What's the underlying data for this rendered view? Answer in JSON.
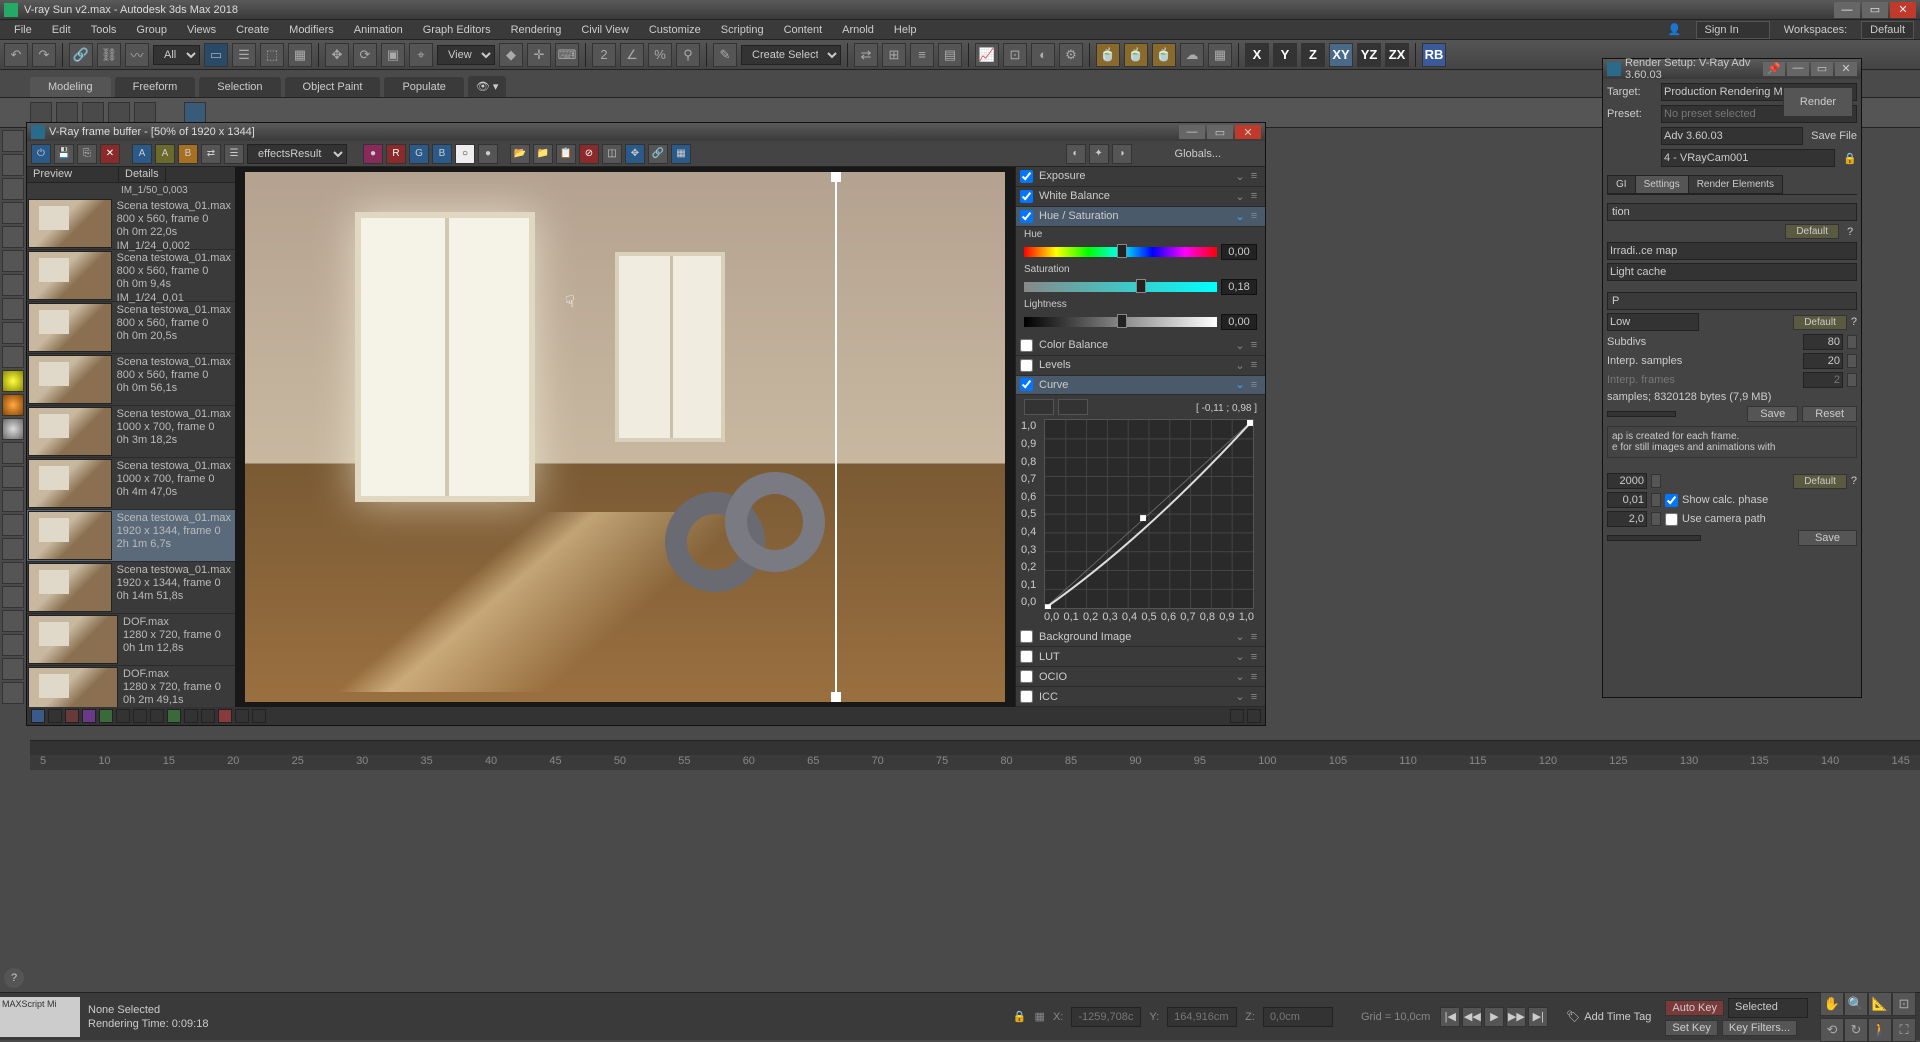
{
  "app": {
    "title": "V-ray Sun v2.max - Autodesk 3ds Max 2018",
    "signin": "Sign In",
    "workspaces_label": "Workspaces:",
    "workspaces_value": "Default"
  },
  "menu": [
    "File",
    "Edit",
    "Tools",
    "Group",
    "Views",
    "Create",
    "Modifiers",
    "Animation",
    "Graph Editors",
    "Rendering",
    "Civil View",
    "Customize",
    "Scripting",
    "Content",
    "Arnold",
    "Help"
  ],
  "toolbar_selects": {
    "all": "All",
    "view": "View",
    "selset": "Create Selection Se"
  },
  "axis_buttons": [
    "X",
    "Y",
    "Z",
    "XY",
    "YZ",
    "ZX"
  ],
  "rb_button": "RB",
  "ribbon": {
    "tabs": [
      "Modeling",
      "Freeform",
      "Selection",
      "Object Paint",
      "Populate"
    ],
    "active": "Modeling"
  },
  "vfb": {
    "title": "V-Ray frame buffer - [50% of 1920 x 1344]",
    "channel": "effectsResult",
    "globals": "Globals...",
    "letters": {
      "a": "A",
      "a2": "A",
      "b": "B"
    },
    "history": {
      "headers": {
        "preview": "Preview",
        "details": "Details"
      },
      "first_line": "IM_1/50_0,003",
      "items": [
        {
          "file": "Scena testowa_01.max",
          "res": "800 x 560, frame 0",
          "time": "0h 0m 22,0s",
          "im": "IM_1/24_0,002"
        },
        {
          "file": "Scena testowa_01.max",
          "res": "800 x 560, frame 0",
          "time": "0h 0m 9,4s",
          "im": "IM_1/24_0,01"
        },
        {
          "file": "Scena testowa_01.max",
          "res": "800 x 560, frame 0",
          "time": "0h 0m 20,5s",
          "im": ""
        },
        {
          "file": "Scena testowa_01.max",
          "res": "800 x 560, frame 0",
          "time": "0h 0m 56,1s",
          "im": ""
        },
        {
          "file": "Scena testowa_01.max",
          "res": "1000 x 700, frame 0",
          "time": "0h 3m 18,2s",
          "im": ""
        },
        {
          "file": "Scena testowa_01.max",
          "res": "1000 x 700, frame 0",
          "time": "0h 4m 47,0s",
          "im": ""
        },
        {
          "file": "Scena testowa_01.max",
          "res": "1920 x 1344, frame 0",
          "time": "2h 1m 6,7s",
          "im": "",
          "selected": true
        },
        {
          "file": "Scena testowa_01.max",
          "res": "1920 x 1344, frame 0",
          "time": "0h 14m 51,8s",
          "im": ""
        },
        {
          "file": "DOF.max",
          "res": "1280 x 720, frame 0",
          "time": "0h 1m 12,8s",
          "im": ""
        },
        {
          "file": "DOF.max",
          "res": "1280 x 720, frame 0",
          "time": "0h 2m 49,1s",
          "im": ""
        }
      ]
    },
    "cc": {
      "exposure": "Exposure",
      "white_balance": "White Balance",
      "hue_sat": "Hue / Saturation",
      "hue_label": "Hue",
      "hue_value": "0,00",
      "sat_label": "Saturation",
      "sat_value": "0,18",
      "light_label": "Lightness",
      "light_value": "0,00",
      "color_balance": "Color Balance",
      "levels": "Levels",
      "curve": "Curve",
      "curve_coords": "[ -0,11 ; 0,98 ]",
      "bg_image": "Background Image",
      "lut": "LUT",
      "ocio": "OCIO",
      "icc": "ICC"
    },
    "curve_y": [
      "1,0",
      "0,9",
      "0,8",
      "0,7",
      "0,6",
      "0,5",
      "0,4",
      "0,3",
      "0,2",
      "0,1",
      "0,0"
    ],
    "curve_x": [
      "0,0",
      "0,1",
      "0,2",
      "0,3",
      "0,4",
      "0,5",
      "0,6",
      "0,7",
      "0,8",
      "0,9",
      "1,0"
    ]
  },
  "render_setup": {
    "title": "Render Setup: V-Ray Adv 3.60.03",
    "target_label": "Target:",
    "target_value": "Production Rendering Mode",
    "preset_label": "Preset:",
    "preset_value": "No preset selected",
    "renderer_value": "Adv 3.60.03",
    "savefile": "Save File",
    "view_value": "4 - VRayCam001",
    "render_btn": "Render",
    "tabs": [
      "GI",
      "Settings",
      "Render Elements"
    ],
    "section_title": "tion",
    "default_btn": "Default",
    "irrad": "Irradi..ce map",
    "light_cache_label": "Light cache",
    "p_label": "P",
    "low": "Low",
    "subdivs_label": "Subdivs",
    "subdivs_val": "80",
    "interp_label": "Interp. samples",
    "interp_val": "20",
    "interp_frames": "Interp. frames",
    "interp_frames_val": "2",
    "samples_info": "samples; 8320128 bytes (7,9 MB)",
    "save_btn": "Save",
    "reset_btn": "Reset",
    "note": "ap is created for each frame.\ne for still images and animations with",
    "val_2000": "2000",
    "val_001": "0,01",
    "val_20": "2,0",
    "show_calc": "Show calc. phase",
    "use_camera": "Use camera path"
  },
  "timeline_ticks": [
    "5",
    "10",
    "15",
    "20",
    "25",
    "30",
    "35",
    "40",
    "45",
    "50",
    "55",
    "60",
    "65",
    "70",
    "75",
    "80",
    "85",
    "90",
    "95",
    "100",
    "105",
    "110",
    "115",
    "120",
    "125",
    "130",
    "135",
    "140",
    "145"
  ],
  "status": {
    "script": "MAXScript Mi",
    "none_selected": "None Selected",
    "render_time": "Rendering Time:  0:09:18",
    "x": "X:",
    "xval": "-1259,708c",
    "y": "Y:",
    "yval": "164,916cm",
    "z": "Z:",
    "zval": "0,0cm",
    "grid": "Grid = 10,0cm",
    "add_time_tag": "Add Time Tag",
    "auto_key": "Auto Key",
    "selected": "Selected",
    "set_key": "Set Key",
    "key_filters": "Key Filters..."
  }
}
